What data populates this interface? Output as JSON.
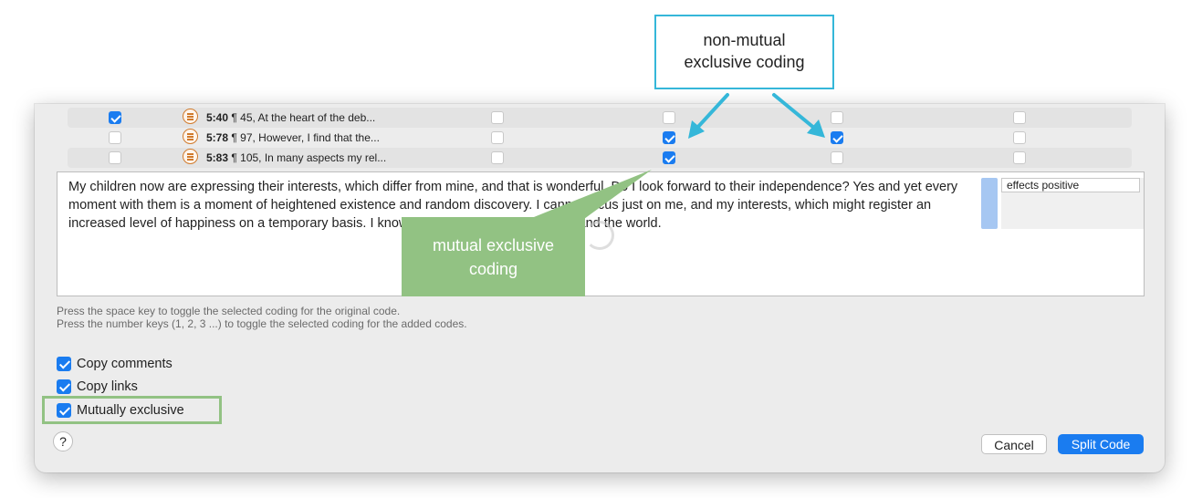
{
  "rows": [
    {
      "checked": true,
      "id": "5:40",
      "para": "¶ 45, At the heart of the deb...",
      "codes": [
        false,
        false,
        false,
        false
      ]
    },
    {
      "checked": false,
      "id": "5:78",
      "para": "¶ 97, However, I find that the...",
      "codes": [
        false,
        true,
        true,
        false
      ]
    },
    {
      "checked": false,
      "id": "5:83",
      "para": "¶ 105, In many aspects my rel...",
      "codes": [
        false,
        true,
        false,
        false
      ]
    }
  ],
  "quotation_text": "My children now are expressing their interests, which differ from mine, and that is wonderful. Do I look forward to their independence? Yes and yet every moment with them is a moment of heightened existence and random discovery. I cannot focus just on me, and my interests, which might register an increased level of happiness on a temporary basis. I know so much more about myself and the world.",
  "code_label": "effects positive",
  "code_color": "#a6c7f2",
  "hints": [
    "Press the space key to toggle the selected coding for the original code.",
    "Press the number keys (1, 2, 3 ...) to toggle the selected coding for the added codes."
  ],
  "options": {
    "copy_comments": {
      "label": "Copy comments",
      "checked": true
    },
    "copy_links": {
      "label": "Copy links",
      "checked": true
    },
    "mutually_exclusive": {
      "label": "Mutually exclusive",
      "checked": true
    }
  },
  "help_label": "?",
  "buttons": {
    "cancel": "Cancel",
    "split": "Split Code"
  },
  "callouts": {
    "blue": "non-mutual\nexclusive coding",
    "green": "mutual exclusive\ncoding"
  },
  "colors": {
    "accent": "#1a7cf0",
    "callout_blue": "#35b7d9",
    "callout_green": "#92c283",
    "quote_icon": "#d07a2c"
  },
  "icons": {
    "quotation": "quotation-icon",
    "help": "help-icon",
    "spinner": "loading-spinner-icon"
  }
}
